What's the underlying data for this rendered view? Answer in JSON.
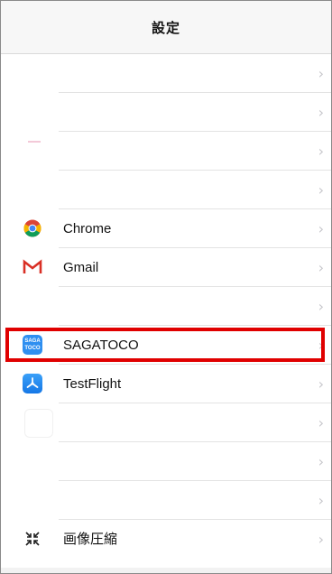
{
  "nav": {
    "title": "設定"
  },
  "chevron": "›",
  "rows": [
    {
      "label": "",
      "icon": ""
    },
    {
      "label": "",
      "icon": ""
    },
    {
      "label": "",
      "icon": ""
    },
    {
      "label": "",
      "icon": ""
    },
    {
      "label": "Chrome",
      "icon": "chrome-icon"
    },
    {
      "label": "Gmail",
      "icon": "gmail-icon"
    },
    {
      "label": "",
      "icon": ""
    },
    {
      "label": "SAGATOCO",
      "icon": "sagatoco-icon",
      "icon_text_top": "SAGA",
      "icon_text_bottom": "TOCO",
      "highlighted": true
    },
    {
      "label": "TestFlight",
      "icon": "testflight-icon"
    },
    {
      "label": "",
      "icon": ""
    },
    {
      "label": "",
      "icon": ""
    },
    {
      "label": "",
      "icon": ""
    },
    {
      "label": "画像圧縮",
      "icon": "image-compress-icon"
    }
  ],
  "colors": {
    "highlight": "#e00000",
    "chevron": "#c7c7cc",
    "gmail_red": "#d93025",
    "sagatoco_blue": "#2f8ff0",
    "testflight_blue": "#1b8cf0"
  }
}
